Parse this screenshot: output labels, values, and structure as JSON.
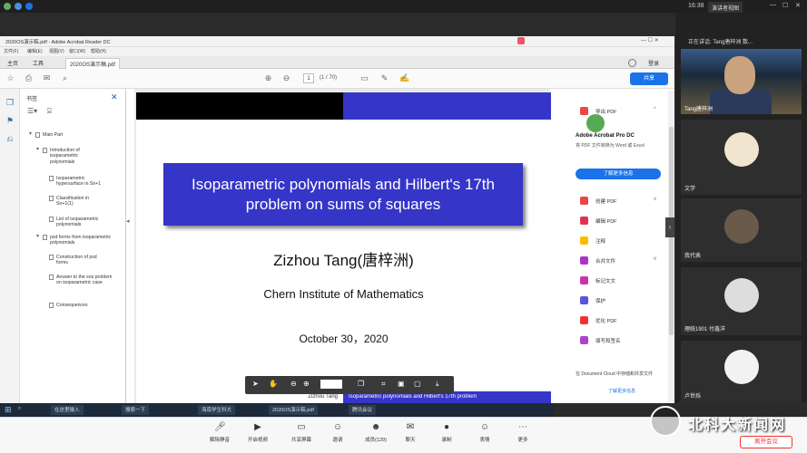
{
  "top": {
    "time": "16:38",
    "view_button": "演讲者视图"
  },
  "reader": {
    "window_title": "2020OS演示稿.pdf - Adobe Acrobat Reader DC",
    "menu": [
      "文件(F)",
      "编辑(E)",
      "视图(V)",
      "窗口(W)",
      "帮助(H)"
    ],
    "tabs": {
      "home": "主页",
      "tools": "工具",
      "doc": "2020OS演示稿.pdf"
    },
    "login": "登录",
    "page": {
      "current": "1",
      "total": "(1 / 70)"
    },
    "share": "共享"
  },
  "bookmarks": {
    "header": "书签",
    "items": [
      {
        "label": "Main Part",
        "level": 0
      },
      {
        "label": "Introduction of isoparametric polynomials",
        "level": 1
      },
      {
        "label": "Isoparametric hypersurface in Sn+1",
        "level": 2
      },
      {
        "label": "Classification in Sn+1(1)",
        "level": 2
      },
      {
        "label": "List of isoparametric polynomials",
        "level": 2
      },
      {
        "label": "psd forms from isoparametric polynomials",
        "level": 1
      },
      {
        "label": "Construction of psd forms",
        "level": 2
      },
      {
        "label": "Answer to the sos problem on isoparametric case",
        "level": 2
      },
      {
        "label": "Consequences",
        "level": 2
      }
    ]
  },
  "slide": {
    "title_line1": "Isoparametric polynomials and Hilbert's 17th",
    "title_line2": "problem on sums of squares",
    "author": "Zizhou Tang(唐梓洲)",
    "institute": "Chern Institute of Mathematics",
    "date": "October 30，2020",
    "footer_left": "Zizhou Tang",
    "footer_right": "Isoparametric polynomials and Hilbert's 17th problem"
  },
  "floatbar": {
    "zoom": "171%"
  },
  "rightpanel": {
    "export_pdf": "导出 PDF",
    "product": "Adobe Acrobat Pro DC",
    "desc": "将 PDF 文件转换为 Word 或 Excel",
    "get_more": "了解更多信息",
    "items": [
      "创建 PDF",
      "编辑 PDF",
      "注释",
      "合并文件",
      "标记文文",
      "保护",
      "优化 PDF",
      "填写和签名"
    ],
    "cloud": "在 Document Cloud 中存储和共享文件",
    "learn": "了解更多信息"
  },
  "taskbar": {
    "search": "在这里输入",
    "items": [
      "搜索一下",
      "海南学生科大",
      "2020OS演示稿.pdf",
      "腾讯会议"
    ]
  },
  "side": {
    "speaking": "正在讲话: Tang唐梓洲 数...",
    "video_name": "Tang唐梓洲",
    "participants": [
      "文学",
      "我代表",
      "理统1901 付鑫洋",
      "卢世烁"
    ]
  },
  "meeting": {
    "buttons": [
      "解除静音",
      "开启视频",
      "共享屏幕",
      "邀请",
      "成员(129)",
      "聊天",
      "录制",
      "表情",
      "更多"
    ],
    "leave": "离开会议"
  },
  "watermark": {
    "text": "北科大新闻网"
  }
}
